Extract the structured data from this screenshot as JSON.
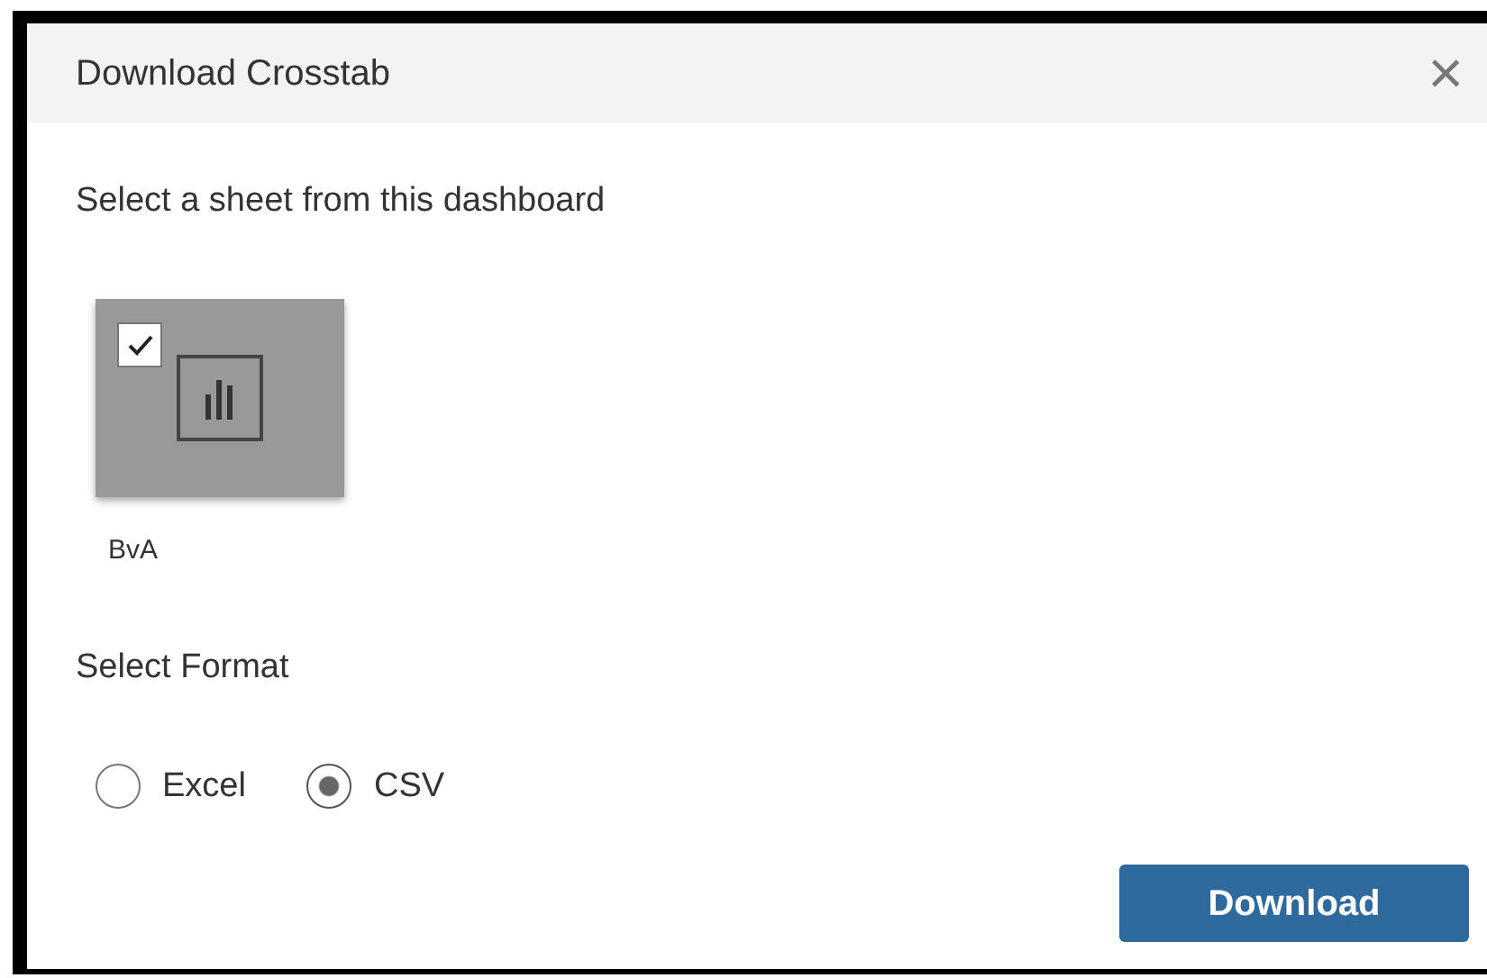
{
  "dialog": {
    "title": "Download Crosstab",
    "close": "×"
  },
  "sheet_section": {
    "label": "Select a sheet from this dashboard",
    "sheets": [
      {
        "name": "BvA",
        "checked": true
      }
    ]
  },
  "format_section": {
    "label": "Select Format",
    "options": [
      {
        "label": "Excel",
        "selected": false
      },
      {
        "label": "CSV",
        "selected": true
      }
    ]
  },
  "buttons": [
    {
      "label": "Download"
    }
  ]
}
